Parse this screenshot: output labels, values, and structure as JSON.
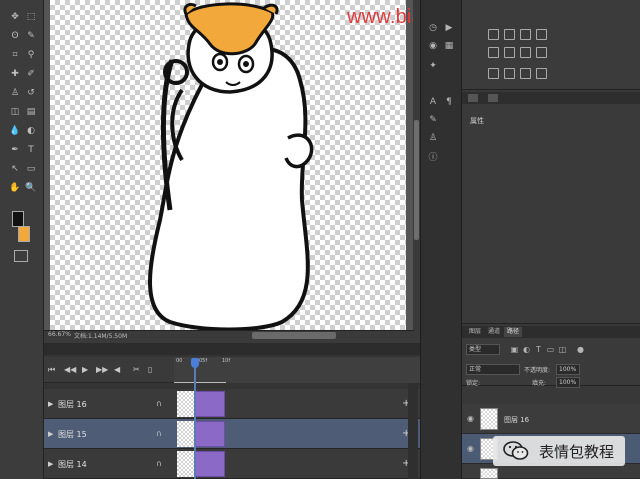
{
  "watermark": "www.biaoqingbaoshes.com",
  "canvas": {
    "zoom": "66.67%",
    "doc_info": "文档:1.14M/5.50M"
  },
  "toolbar": {
    "tools": [
      {
        "name": "move-tool-icon",
        "glyph": "✥"
      },
      {
        "name": "marquee-tool-icon",
        "glyph": "⬚"
      },
      {
        "name": "lasso-tool-icon",
        "glyph": "ʘ"
      },
      {
        "name": "quick-select-tool-icon",
        "glyph": "✎"
      },
      {
        "name": "crop-tool-icon",
        "glyph": "⌗"
      },
      {
        "name": "eyedropper-tool-icon",
        "glyph": "⚲"
      },
      {
        "name": "healing-brush-tool-icon",
        "glyph": "✚"
      },
      {
        "name": "brush-tool-icon",
        "glyph": "✐"
      },
      {
        "name": "clone-stamp-tool-icon",
        "glyph": "♙"
      },
      {
        "name": "history-brush-tool-icon",
        "glyph": "↺"
      },
      {
        "name": "eraser-tool-icon",
        "glyph": "◫"
      },
      {
        "name": "gradient-tool-icon",
        "glyph": "▤"
      },
      {
        "name": "blur-tool-icon",
        "glyph": "💧"
      },
      {
        "name": "dodge-tool-icon",
        "glyph": "◐"
      },
      {
        "name": "pen-tool-icon",
        "glyph": "✒"
      },
      {
        "name": "type-tool-icon",
        "glyph": "T"
      },
      {
        "name": "path-select-tool-icon",
        "glyph": "↖"
      },
      {
        "name": "shape-tool-icon",
        "glyph": "▭"
      },
      {
        "name": "hand-tool-icon",
        "glyph": "✋"
      },
      {
        "name": "zoom-tool-icon",
        "glyph": "🔍"
      }
    ]
  },
  "properties": {
    "label": "属性"
  },
  "layers": {
    "tabs": [
      "图层",
      "通道",
      "路径"
    ],
    "active_tab": "路径",
    "kind_filter": "类型",
    "blend_mode": "正常",
    "opacity_label": "不透明度:",
    "opacity": "100%",
    "fill_label": "填充:",
    "fill": "100%",
    "lock_label": "锁定:",
    "rows": [
      {
        "name": "图层 16",
        "selected": false
      },
      {
        "name": "",
        "selected": true
      }
    ]
  },
  "wechat": {
    "label": "表情包教程"
  },
  "timeline": {
    "ruler": [
      "00",
      "05f",
      "10f"
    ],
    "tracks": [
      {
        "name": "图层 16",
        "selected": false
      },
      {
        "name": "图层 15",
        "selected": true
      },
      {
        "name": "图层 14",
        "selected": false
      }
    ]
  },
  "colors": {
    "accent_blue": "#4a7ed8",
    "clip_purple": "#8b69c7",
    "watermark_red": "#e23a3a",
    "hamster_orange": "#f2a83a"
  }
}
